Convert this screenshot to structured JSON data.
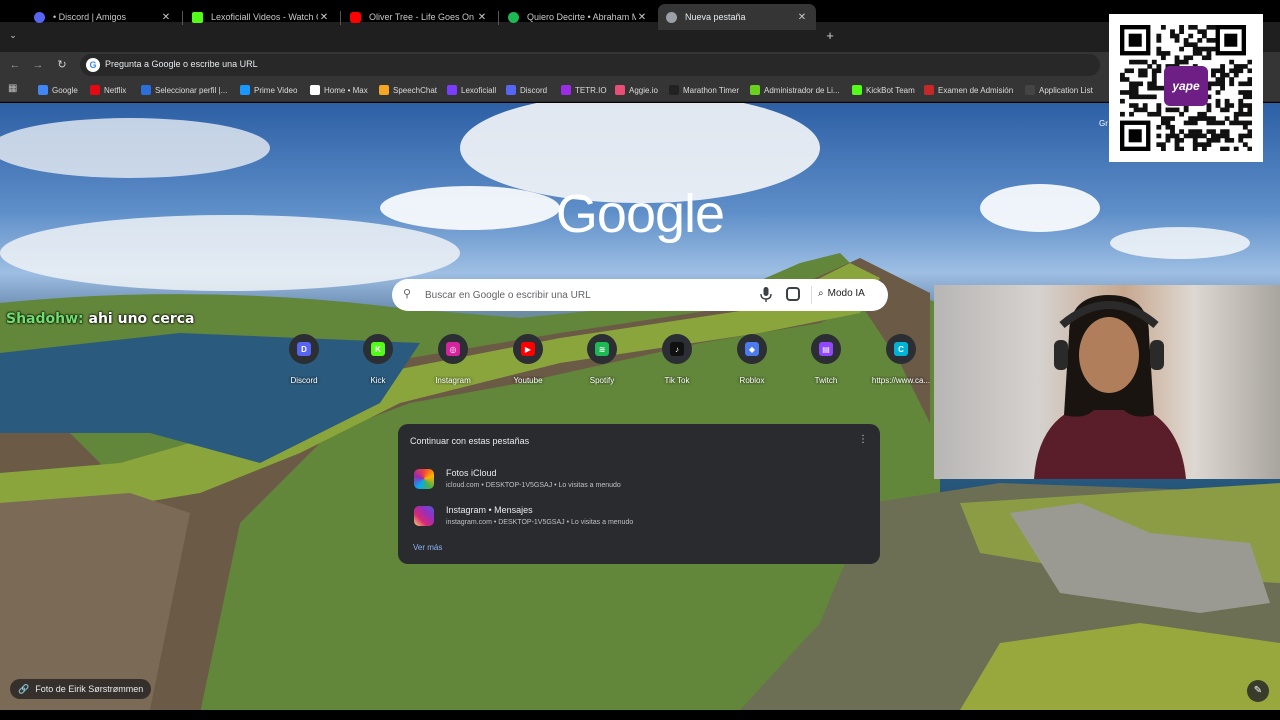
{
  "browser": {
    "tabs": [
      {
        "title": "• Discord | Amigos",
        "icon": "discord-icon",
        "color": "#5865f2"
      },
      {
        "title": "Lexoficiall Videos - Watch On-D",
        "icon": "kick-icon",
        "color": "#53fc18"
      },
      {
        "title": "Oliver Tree - Life Goes On [Mus",
        "icon": "youtube-icon",
        "color": "#ff0000"
      },
      {
        "title": "Quiero Decirte • Abraham Mate",
        "icon": "spotify-icon",
        "color": "#1db954"
      },
      {
        "title": "Nueva pestaña",
        "icon": "chrome-icon",
        "color": "#9aa0a6"
      }
    ],
    "close_glyph": "✕",
    "new_tab_glyph": "+",
    "omnibox_placeholder": "Pregunta a Google o escribe una URL",
    "bookmarks": [
      {
        "label": "Google",
        "color": "#4285f4"
      },
      {
        "label": "Netflix",
        "color": "#e50914"
      },
      {
        "label": "Seleccionar perfil |...",
        "color": "#2a6fdb"
      },
      {
        "label": "Prime Video",
        "color": "#1a98ff"
      },
      {
        "label": "Home • Max",
        "color": "#ffffff"
      },
      {
        "label": "SpeechChat",
        "color": "#f5a623"
      },
      {
        "label": "Lexoficiall",
        "color": "#7a3cff"
      },
      {
        "label": "Discord",
        "color": "#5865f2"
      },
      {
        "label": "TETR.IO",
        "color": "#9b2ce8"
      },
      {
        "label": "Aggie.io",
        "color": "#e94e77"
      },
      {
        "label": "Marathon Timer",
        "color": "#222222"
      },
      {
        "label": "Administrador de Li...",
        "color": "#6ad21e"
      },
      {
        "label": "KickBot Team",
        "color": "#53fc18"
      },
      {
        "label": "Examen de Admisión",
        "color": "#c62828"
      },
      {
        "label": "Application List",
        "color": "#444444"
      }
    ]
  },
  "newtab": {
    "logo": "Google",
    "search_placeholder": "Buscar en Google o escribir una URL",
    "ai_mode_label": "Modo IA",
    "shortcuts": [
      {
        "label": "Discord",
        "color": "#5865f2",
        "glyph": "D"
      },
      {
        "label": "Kick",
        "color": "#53fc18",
        "glyph": "K"
      },
      {
        "label": "Instagram",
        "color": "#d6249f",
        "glyph": "◎"
      },
      {
        "label": "Youtube",
        "color": "#ff0000",
        "glyph": "▶"
      },
      {
        "label": "Spotify",
        "color": "#1db954",
        "glyph": "≋"
      },
      {
        "label": "Tik Tok",
        "color": "#111111",
        "glyph": "♪"
      },
      {
        "label": "Roblox",
        "color": "#4b7bec",
        "glyph": "◆"
      },
      {
        "label": "Twitch",
        "color": "#9146ff",
        "glyph": "▤"
      },
      {
        "label": "https://www.ca...",
        "color": "#00b4d8",
        "glyph": "C"
      }
    ],
    "continue_panel": {
      "title": "Continuar con estas pestañas",
      "items": [
        {
          "title": "Fotos iCloud",
          "subtitle": "icloud.com • DESKTOP-1V5GSAJ • Lo visitas a menudo",
          "icon": "icloud-photos-icon"
        },
        {
          "title": "Instagram • Mensajes",
          "subtitle": "instagram.com • DESKTOP-1V5GSAJ • Lo visitas a menudo",
          "icon": "instagram-icon"
        }
      ],
      "more_label": "Ver más"
    },
    "photo_credit": "Foto de Eirik Sørstrømmen",
    "corner_text": "Gr"
  },
  "stream_overlay": {
    "chat_user": "Shadohw:",
    "chat_message": " ahi uno cerca",
    "qr_brand": "yape"
  }
}
